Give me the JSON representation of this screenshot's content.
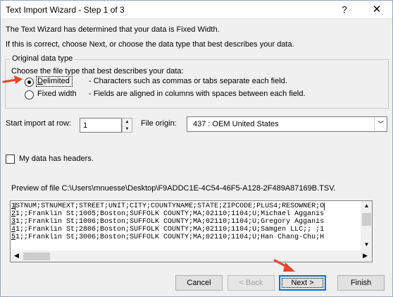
{
  "window": {
    "title": "Text Import Wizard - Step 1 of 3",
    "help_label": "?",
    "close_label": "✕"
  },
  "intro": {
    "line1": "The Text Wizard has determined that your data is Fixed Width.",
    "line2": "If this is correct, choose Next, or choose the data type that best describes your data."
  },
  "original_data_type": {
    "legend": "Original data type",
    "prompt": "Choose the file type that best describes your data:",
    "options": [
      {
        "label": "Delimited",
        "description": "- Characters such as commas or tabs separate each field.",
        "selected": true
      },
      {
        "label": "Fixed width",
        "description": "- Fields are aligned in columns with spaces between each field.",
        "selected": false
      }
    ]
  },
  "start_import": {
    "label": "Start import at row:",
    "value": "1"
  },
  "file_origin": {
    "label": "File origin:",
    "value": "437 : OEM United States"
  },
  "headers_checkbox": {
    "label": "My data has headers.",
    "checked": false
  },
  "preview": {
    "label": "Preview of file C:\\Users\\mnuesse\\Desktop\\F9ADDC1E-4C54-46F5-A128-2F489A87169B.TSV.",
    "lines": [
      {
        "num": "1",
        "text": "STNUM;STNUMEXT;STREET;UNIT;CITY;COUNTYNAME;STATE;ZIPCODE;PLUS4;RESOWNER;O"
      },
      {
        "num": "2",
        "text": "1;;Franklin St;1005;Boston;SUFFOLK COUNTY;MA;02110;1104;U;Michael Agganis"
      },
      {
        "num": "3",
        "text": "1;;Franklin St;1006;Boston;SUFFOLK COUNTY;MA;02110;1104;U;Gregory Agganis"
      },
      {
        "num": "4",
        "text": "1;;Franklin St;2806;Boston;SUFFOLK COUNTY;MA;02110;1104;U;Samgen LLC;; ;1"
      },
      {
        "num": "5",
        "text": "1;;Franklin St;3006;Boston;SUFFOLK COUNTY;MA;02110;1104;U;Han Chang-Chu;H"
      }
    ]
  },
  "buttons": {
    "cancel": "Cancel",
    "back": "< Back",
    "next": "Next >",
    "finish": "Finish"
  },
  "colors": {
    "annotation_arrow": "#e8452c",
    "accent": "#0078d7"
  }
}
